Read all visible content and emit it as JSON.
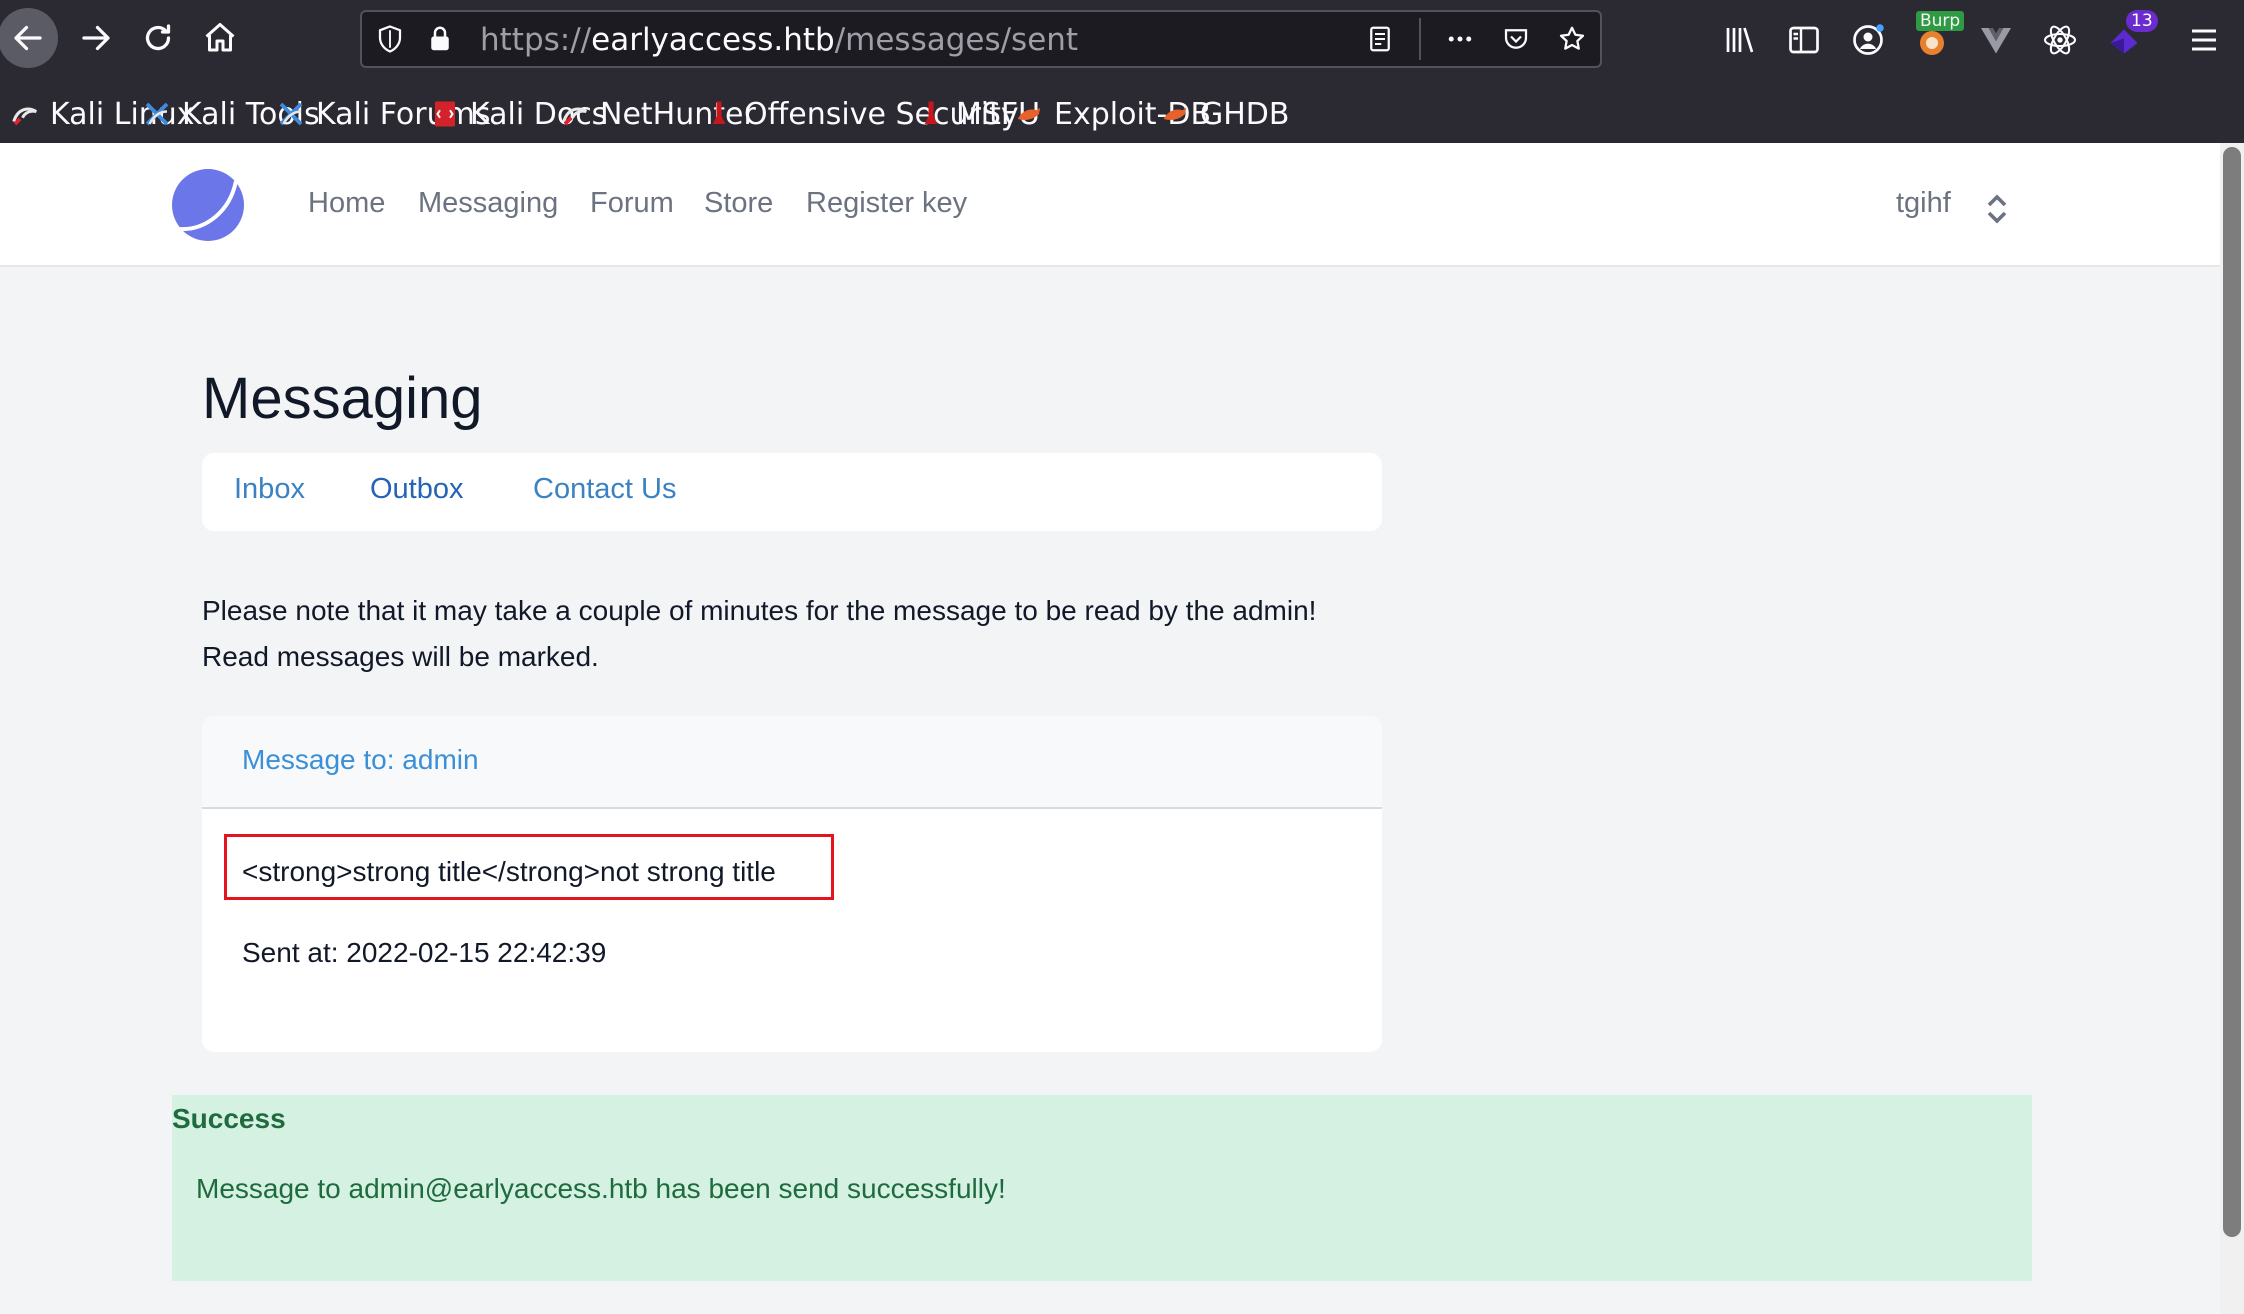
{
  "browser": {
    "url": {
      "scheme": "https://",
      "host": "earlyaccess.htb",
      "path": "/messages/sent"
    },
    "burp_badge": "Burp",
    "extension_count": "13",
    "bookmarks": [
      {
        "label": "Kali Linux",
        "icon": "kali-dragon-icon"
      },
      {
        "label": "Kali Tools",
        "icon": "kali-tools-icon"
      },
      {
        "label": "Kali Forums",
        "icon": "kali-forums-icon"
      },
      {
        "label": "Kali Docs",
        "icon": "kali-docs-icon"
      },
      {
        "label": "NetHunter",
        "icon": "nethunter-icon"
      },
      {
        "label": "Offensive Security",
        "icon": "offsec-icon"
      },
      {
        "label": "MSFU",
        "icon": "msfu-icon"
      },
      {
        "label": "Exploit-DB",
        "icon": "exploitdb-icon"
      },
      {
        "label": "GHDB",
        "icon": "ghdb-icon"
      }
    ]
  },
  "site": {
    "nav": {
      "links": [
        "Home",
        "Messaging",
        "Forum",
        "Store",
        "Register key"
      ],
      "user": "tgihf"
    },
    "page_title": "Messaging",
    "tabs": [
      "Inbox",
      "Outbox",
      "Contact Us"
    ],
    "notice": {
      "line1": "Please note that it may take a couple of minutes for the message to be read by the admin!",
      "line2": "Read messages will be marked."
    },
    "message": {
      "recipient": "Message to: admin",
      "body": "<strong>strong title</strong>not strong title",
      "sent_at": "Sent at: 2022-02-15 22:42:39"
    },
    "alert": {
      "title": "Success",
      "text": "Message to admin@earlyaccess.htb has been send successfully!"
    }
  },
  "colors": {
    "accent_link": "#3b8fd6",
    "success_bg": "#d4f1e2",
    "success_text": "#1f6b3e",
    "highlight_border": "#e3141d",
    "logo": "#6b77e8"
  }
}
